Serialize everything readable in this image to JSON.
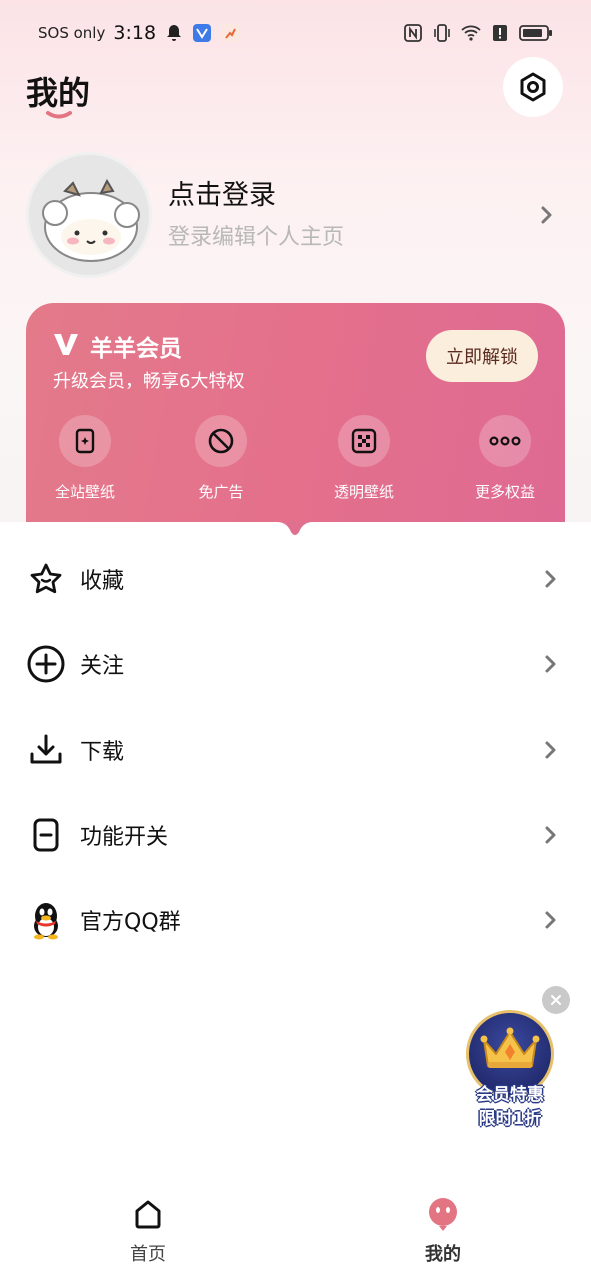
{
  "status_bar": {
    "carrier": "SOS only",
    "time": "3:18"
  },
  "header": {
    "title": "我的"
  },
  "profile": {
    "login_title": "点击登录",
    "login_subtitle": "登录编辑个人主页"
  },
  "vip": {
    "name": "羊羊会员",
    "subtitle": "升级会员，畅享6大特权",
    "unlock_label": "立即解锁",
    "perks": [
      {
        "label": "全站壁纸",
        "icon": "wallpaper-icon"
      },
      {
        "label": "免广告",
        "icon": "no-ads-icon"
      },
      {
        "label": "透明壁纸",
        "icon": "transparent-wallpaper-icon"
      },
      {
        "label": "更多权益",
        "icon": "more-icon"
      }
    ]
  },
  "menu": {
    "items": [
      {
        "label": "收藏",
        "icon": "star-icon"
      },
      {
        "label": "关注",
        "icon": "plus-circle-icon"
      },
      {
        "label": "下载",
        "icon": "download-icon"
      },
      {
        "label": "功能开关",
        "icon": "toggle-icon"
      },
      {
        "label": "官方QQ群",
        "icon": "qq-penguin-icon"
      }
    ]
  },
  "promo": {
    "line1": "会员特惠",
    "line2": "限时1折"
  },
  "bottom_nav": {
    "items": [
      {
        "label": "首页",
        "icon": "home-icon",
        "active": false
      },
      {
        "label": "我的",
        "icon": "profile-face-icon",
        "active": true
      }
    ]
  },
  "colors": {
    "accent": "#e4708c",
    "unlock_button_bg": "#fbeedd",
    "active_nav": "#e37583"
  }
}
